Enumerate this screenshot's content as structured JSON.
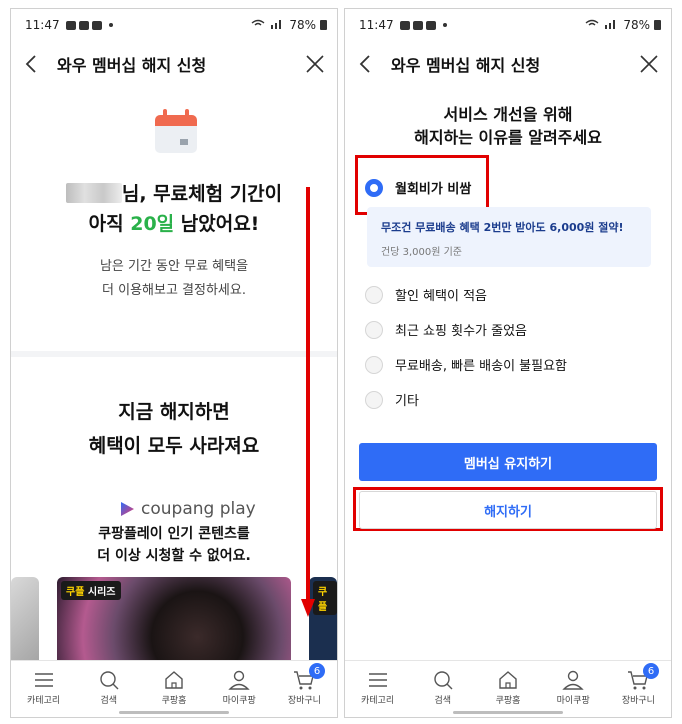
{
  "left": {
    "status": {
      "time": "11:47",
      "battery": "78%"
    },
    "title": "와우 멤버십 해지 신청",
    "notice": {
      "line1_suffix": "님, 무료체험 기간이",
      "line2_prefix": "아직 ",
      "days": "20일",
      "line2_suffix": " 남았어요!",
      "sub1": "남은 기간 동안 무료 혜택을",
      "sub2": "더 이용해보고 결정하세요."
    },
    "lose": {
      "line1": "지금 해지하면",
      "line2": "혜택이 모두 사라져요"
    },
    "coupang_play": {
      "logo": "coupang play",
      "desc1": "쿠팡플레이 인기 콘텐츠를",
      "desc2": "더 이상 시청할 수 없어요."
    },
    "badges": {
      "series_prefix": "쿠플",
      "series_suffix": " 시리즈",
      "right_badge": "쿠플"
    }
  },
  "right": {
    "status": {
      "time": "11:47",
      "battery": "78%"
    },
    "title": "와우 멤버십 해지 신청",
    "heading1": "서비스 개선을 위해",
    "heading2": "해지하는 이유를 알려주세요",
    "reasons": [
      {
        "label": "월회비가 비쌈",
        "selected": true
      },
      {
        "label": "할인 혜택이 적음",
        "selected": false
      },
      {
        "label": "최근 쇼핑 횟수가 줄었음",
        "selected": false
      },
      {
        "label": "무료배송, 빠른 배송이 불필요함",
        "selected": false
      },
      {
        "label": "기타",
        "selected": false
      }
    ],
    "info": {
      "main": "무조건 무료배송 혜택 2번만 받아도 6,000원 절약!",
      "sub": "건당 3,000원 기준"
    },
    "keep_button": "멤버십 유지하기",
    "cancel_button": "해지하기"
  },
  "nav": {
    "items": [
      "카테고리",
      "검색",
      "쿠팡홈",
      "마이쿠팡",
      "장바구니"
    ],
    "cart_count": "6"
  },
  "colors": {
    "accent": "#2f6cf6",
    "highlight_red": "#e10000",
    "days_green": "#2ab14a"
  }
}
